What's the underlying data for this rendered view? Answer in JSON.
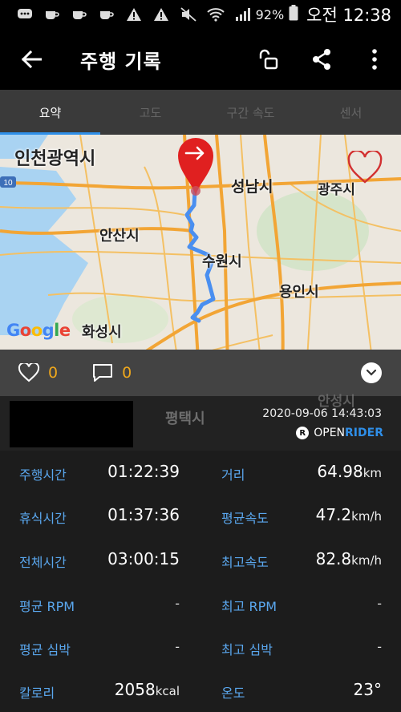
{
  "status_bar": {
    "battery": "92%",
    "clock": "오전 12:38",
    "icons": [
      "chat-bubble-icon",
      "coffee-icon",
      "coffee-icon",
      "coffee-icon",
      "warning-icon",
      "warning-icon",
      "mute-icon",
      "wifi-icon",
      "signal-icon"
    ]
  },
  "app_bar": {
    "title": "주행 기록",
    "back_icon": "back-arrow-icon",
    "actions": [
      "lock-open-icon",
      "share-icon",
      "more-vert-icon"
    ]
  },
  "tabs": [
    {
      "label": "요약",
      "active": true
    },
    {
      "label": "고도",
      "active": false
    },
    {
      "label": "구간 속도",
      "active": false
    },
    {
      "label": "센서",
      "active": false
    }
  ],
  "map": {
    "labels": {
      "incheon": "인천광역시",
      "seongnam": "성남시",
      "gwangju": "광주시",
      "ansan": "안산시",
      "suwon": "수원시",
      "yongin": "용인시",
      "hwaseong": "화성시",
      "anseong": "안성시",
      "pyeongtaek": "평택시",
      "route_badge": "10"
    },
    "google": [
      "G",
      "o",
      "o",
      "g",
      "l",
      "e"
    ],
    "route_color": "#4a8ff0",
    "marker_color": "#e02020"
  },
  "social": {
    "likes": "0",
    "comments": "0"
  },
  "ride": {
    "datetime": "2020-09-06 14:43:03",
    "brand_open": "OPEN",
    "brand_rider": "RIDER",
    "brand_badge": "R"
  },
  "stats": [
    {
      "left_label": "주행시간",
      "left_value": "01:22:39",
      "left_unit": "",
      "right_label": "거리",
      "right_value": "64.98",
      "right_unit": "km"
    },
    {
      "left_label": "휴식시간",
      "left_value": "01:37:36",
      "left_unit": "",
      "right_label": "평균속도",
      "right_value": "47.2",
      "right_unit": "km/h"
    },
    {
      "left_label": "전체시간",
      "left_value": "03:00:15",
      "left_unit": "",
      "right_label": "최고속도",
      "right_value": "82.8",
      "right_unit": "km/h"
    },
    {
      "left_label": "평균 RPM",
      "left_value": "-",
      "left_unit": "",
      "right_label": "최고 RPM",
      "right_value": "-",
      "right_unit": ""
    },
    {
      "left_label": "평균 심박",
      "left_value": "-",
      "left_unit": "",
      "right_label": "최고 심박",
      "right_value": "-",
      "right_unit": ""
    },
    {
      "left_label": "칼로리",
      "left_value": "2058",
      "left_unit": "kcal",
      "right_label": "온도",
      "right_value": "23°",
      "right_unit": ""
    }
  ],
  "colors": {
    "accent": "#2f8fe8",
    "label_blue": "#5aa7ee",
    "count_orange": "#f0a81c"
  }
}
